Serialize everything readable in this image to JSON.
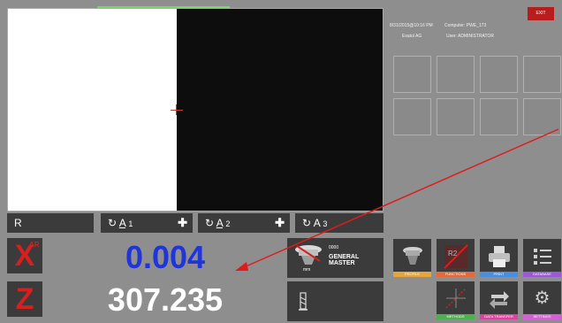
{
  "info": {
    "datetime": "8/31/2015@10:16 PM",
    "computer": "Computer: PWE_173",
    "company": "Exatol AG",
    "user": "User: ADMINISTRATOR"
  },
  "exit_label": "EXIT",
  "selectors": [
    {
      "label": "R"
    },
    {
      "label": "A",
      "sub": "1"
    },
    {
      "label": "A",
      "sub": "2"
    },
    {
      "label": "A",
      "sub": "3"
    }
  ],
  "axes": {
    "x": {
      "letter": "X",
      "mini": "AR",
      "value": "0.004",
      "color": "#1f35d9"
    },
    "z": {
      "letter": "Z",
      "value": "307.235",
      "color": "#ffffff"
    }
  },
  "tool": {
    "number": "0000",
    "name": "GENERAL MASTER",
    "unit": "mm"
  },
  "function_buttons": [
    {
      "label": "PROFILE",
      "color": "#e6a53a",
      "icon": "tool-holder-icon"
    },
    {
      "label": "FUNCTIONS",
      "color": "#e46a3a",
      "icon": "functions-icon"
    },
    {
      "label": "PRINT",
      "color": "#4a8ee0",
      "icon": "printer-icon"
    },
    {
      "label": "DATABASE",
      "color": "#9b59d6",
      "icon": "list-icon"
    },
    {
      "label": "METHODS",
      "color": "#4caf50",
      "icon": "graph-icon"
    },
    {
      "label": "DATA TRANSFER",
      "color": "#e040a0",
      "icon": "transfer-icon"
    },
    {
      "label": "SETTINGS",
      "color": "#d75fd6",
      "icon": "gear-icon"
    }
  ],
  "colors": {
    "accent_red": "#d61f1f",
    "panel": "#3b3b3b",
    "background": "#8e8e8e"
  }
}
